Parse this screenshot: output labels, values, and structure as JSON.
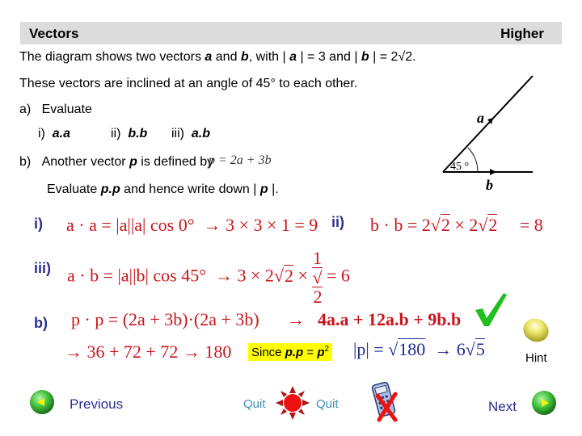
{
  "header": {
    "title": "Vectors",
    "level": "Higher"
  },
  "question": {
    "line1": {
      "prefix": "The diagram shows two vectors ",
      "a": "a",
      "and": " and ",
      "b": "b",
      "mid": ",  with | ",
      "a2": "a",
      "eq1": " | = 3 and | ",
      "b2": "b",
      "eq2": " | = 2√2."
    },
    "line2": "These vectors are inclined at an angle of 45° to each other.",
    "part_a": {
      "label": "a)",
      "text": "Evaluate"
    },
    "sub": [
      {
        "label": "i)",
        "expr": "a.a"
      },
      {
        "label": "ii)",
        "expr": "b.b"
      },
      {
        "label": "iii)",
        "expr": "a.b"
      }
    ],
    "part_b": {
      "label": "b)",
      "text": "Another vector ",
      "p": "p",
      "rest": " is defined by",
      "formula": "p = 2a + 3b"
    },
    "evaluate": {
      "text1": "Evaluate ",
      "pp": "p.p",
      "text2": " and hence write down  | ",
      "p": "p",
      "text3": " |."
    }
  },
  "diagram": {
    "label_a": "a",
    "label_b": "b",
    "angle": "45 °"
  },
  "answers": {
    "i": {
      "label": "i)",
      "lhs": "a · a = |a||a| cos 0°",
      "arrow": "→",
      "rhs": "3 × 3 × 1 = 9"
    },
    "ii": {
      "label": "ii)",
      "lhs": "b · b = 2",
      "r1": "2",
      "times": " × 2",
      "r2": "2",
      "rhs": "= 8"
    },
    "iii": {
      "label": "iii)",
      "lhs": "a · b = |a||b| cos 45°",
      "arrow": "→",
      "mid": "3 × 2",
      "r1": "2",
      "times": " ×",
      "num": "1",
      "den": "2",
      "rhs": "= 6"
    },
    "b": {
      "label": "b)",
      "lhs": "p · p = (2a + 3b)·(2a + 3b)",
      "arrow": "→",
      "expand": "4a.a + 12a.b + 9b.b",
      "line2": "→ 36 + 72 + 72  → 180",
      "since": "Since ",
      "since_pp": "p.p",
      "since_eq": " = ",
      "since_p": "p",
      "since_sup": "2",
      "mod_lhs": "|p| = √",
      "mod_rad": "180",
      "mod_arrow": "→  6√",
      "mod_rad2": "5"
    }
  },
  "nav": {
    "previous": "Previous",
    "quit_left": "Quit",
    "quit_right": "Quit",
    "next": "Next",
    "hint": "Hint"
  },
  "colors": {
    "answer_red": "#c8151b",
    "label_blue": "#2b2e8f",
    "highlight": "#ffff00",
    "check_green": "#1dc01d"
  }
}
